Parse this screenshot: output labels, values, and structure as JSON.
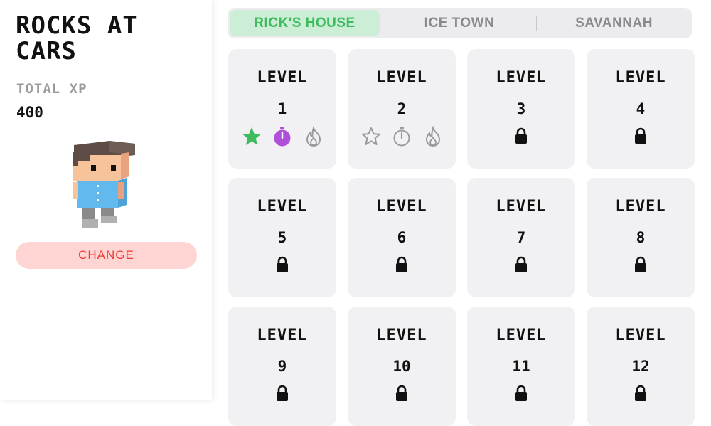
{
  "sidebar": {
    "title": "ROCKS AT CARS",
    "xp_label": "TOTAL XP",
    "xp_value": "400",
    "change_label": "CHANGE"
  },
  "tabs": [
    {
      "label": "RICK'S HOUSE",
      "selected": true
    },
    {
      "label": "ICE TOWN",
      "selected": false
    },
    {
      "label": "SAVANNAH",
      "selected": false
    }
  ],
  "level_label": "LEVEL",
  "levels": [
    {
      "number": "1",
      "state": "unlocked",
      "badges": [
        "star-earned",
        "timer-earned",
        "flame-empty"
      ]
    },
    {
      "number": "2",
      "state": "unlocked",
      "badges": [
        "star-empty",
        "timer-empty",
        "flame-empty"
      ]
    },
    {
      "number": "3",
      "state": "locked"
    },
    {
      "number": "4",
      "state": "locked"
    },
    {
      "number": "5",
      "state": "locked"
    },
    {
      "number": "6",
      "state": "locked"
    },
    {
      "number": "7",
      "state": "locked"
    },
    {
      "number": "8",
      "state": "locked"
    },
    {
      "number": "9",
      "state": "locked"
    },
    {
      "number": "10",
      "state": "locked"
    },
    {
      "number": "11",
      "state": "locked"
    },
    {
      "number": "12",
      "state": "locked"
    }
  ],
  "colors": {
    "accent_green": "#3dbb5e",
    "tab_selected_bg": "#cdeed6",
    "timer_purple": "#b04fd9",
    "change_text": "#ee3b36",
    "change_bg": "#ffd5d3",
    "card_bg": "#f1f1f3"
  }
}
